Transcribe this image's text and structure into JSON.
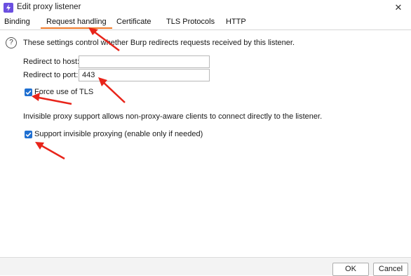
{
  "window": {
    "title": "Edit proxy listener",
    "close_glyph": "✕"
  },
  "tabs": [
    {
      "label": "Binding"
    },
    {
      "label": "Request handling",
      "active": true
    },
    {
      "label": "Certificate"
    },
    {
      "label": "TLS Protocols"
    },
    {
      "label": "HTTP"
    }
  ],
  "main": {
    "description": "These settings control whether Burp redirects requests received by this listener.",
    "redirect_host_label": "Redirect to host:",
    "redirect_host_value": "",
    "redirect_port_label": "Redirect to port:",
    "redirect_port_value": "443",
    "force_tls_label": "Force use of TLS",
    "force_tls_checked": true,
    "invisible_description": "Invisible proxy support allows non-proxy-aware clients to connect directly to the listener.",
    "invisible_label": "Support invisible proxying (enable only if needed)",
    "invisible_checked": true
  },
  "footer": {
    "ok_label": "OK",
    "cancel_label": "Cancel"
  },
  "colors": {
    "tab_underline": "#f07a2a",
    "checkbox": "#1f6fd1",
    "annotation_arrow": "#e8241a",
    "app_icon": "#6b4fe0"
  }
}
